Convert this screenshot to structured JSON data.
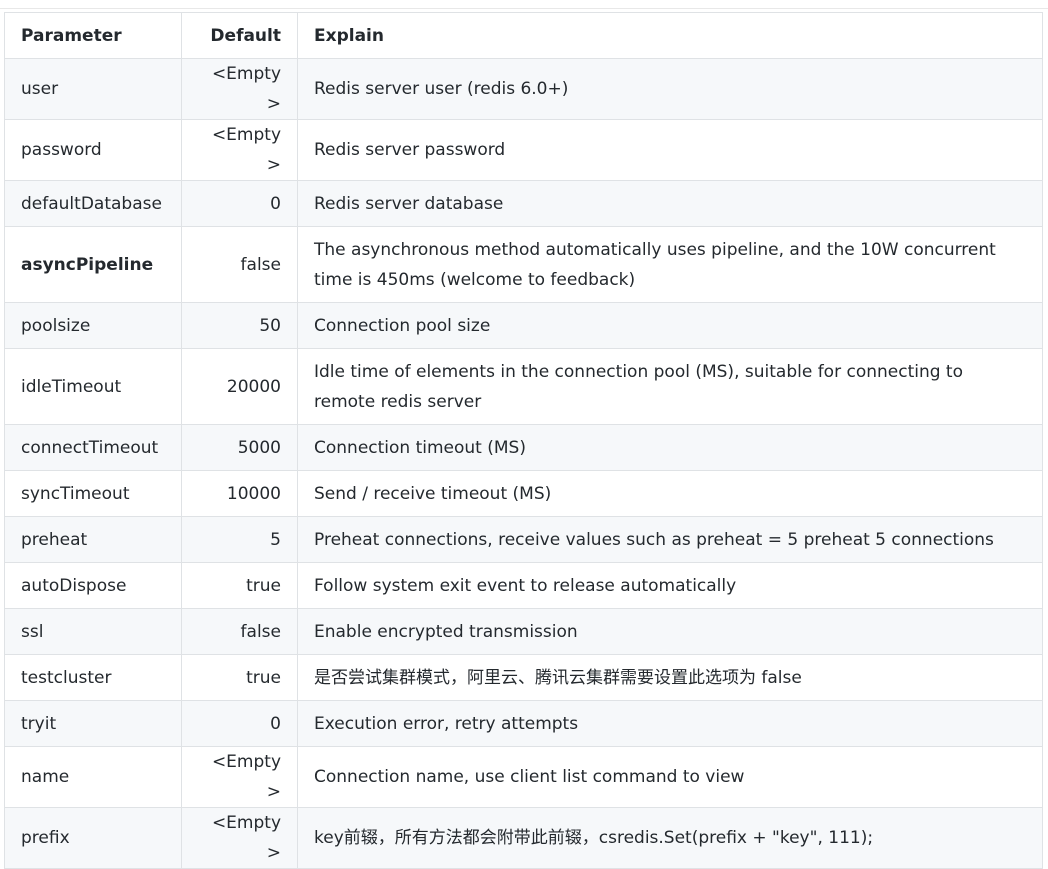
{
  "table": {
    "headers": {
      "parameter": "Parameter",
      "default": "Default",
      "explain": "Explain"
    },
    "rows": [
      {
        "parameter": "user",
        "default": "<Empty>",
        "explain": "Redis server user (redis 6.0+)"
      },
      {
        "parameter": "password",
        "default": "<Empty>",
        "explain": "Redis server password"
      },
      {
        "parameter": "defaultDatabase",
        "default": "0",
        "explain": "Redis server database"
      },
      {
        "parameter": "asyncPipeline",
        "default": "false",
        "explain": "The asynchronous method automatically uses pipeline, and the 10W concurrent time is 450ms (welcome to feedback)"
      },
      {
        "parameter": "poolsize",
        "default": "50",
        "explain": "Connection pool size"
      },
      {
        "parameter": "idleTimeout",
        "default": "20000",
        "explain": "Idle time of elements in the connection pool (MS), suitable for connecting to remote redis server"
      },
      {
        "parameter": "connectTimeout",
        "default": "5000",
        "explain": "Connection timeout (MS)"
      },
      {
        "parameter": "syncTimeout",
        "default": "10000",
        "explain": "Send / receive timeout (MS)"
      },
      {
        "parameter": "preheat",
        "default": "5",
        "explain": "Preheat connections, receive values such as preheat = 5 preheat 5 connections"
      },
      {
        "parameter": "autoDispose",
        "default": "true",
        "explain": "Follow system exit event to release automatically"
      },
      {
        "parameter": "ssl",
        "default": "false",
        "explain": "Enable encrypted transmission"
      },
      {
        "parameter": "testcluster",
        "default": "true",
        "explain": "是否尝试集群模式，阿里云、腾讯云集群需要设置此选项为 false"
      },
      {
        "parameter": "tryit",
        "default": "0",
        "explain": "Execution error, retry attempts"
      },
      {
        "parameter": "name",
        "default": "<Empty>",
        "explain": "Connection name, use client list command to view"
      },
      {
        "parameter": "prefix",
        "default": "<Empty>",
        "explain": "key前辍，所有方法都会附带此前辍，csredis.Set(prefix + \"key\", 111);"
      }
    ]
  }
}
